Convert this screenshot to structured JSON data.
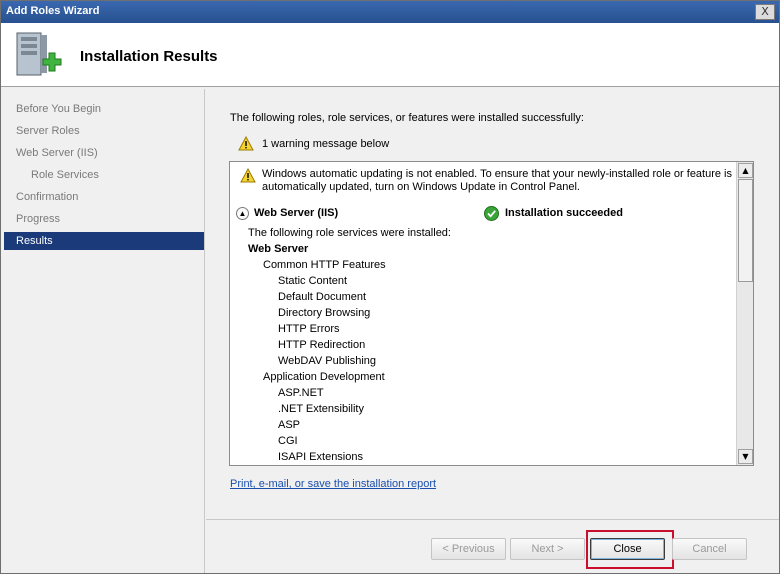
{
  "window": {
    "title": "Add Roles Wizard",
    "close_glyph": "X"
  },
  "header": {
    "title": "Installation Results",
    "icon": "server-add-icon"
  },
  "sidebar": {
    "items": [
      {
        "label": "Before You Begin",
        "state": "done"
      },
      {
        "label": "Server Roles",
        "state": "done"
      },
      {
        "label": "Web Server (IIS)",
        "state": "done"
      },
      {
        "label": "Role Services",
        "state": "done"
      },
      {
        "label": "Confirmation",
        "state": "done"
      },
      {
        "label": "Progress",
        "state": "done"
      },
      {
        "label": "Results",
        "state": "active"
      }
    ]
  },
  "main": {
    "lead": "The following roles, role services, or features were installed successfully:",
    "warning_summary": "1 warning message below",
    "results": {
      "warning_message": "Windows automatic updating is not enabled. To ensure that your newly-installed role or feature is automatically updated, turn on Windows Update in Control Panel.",
      "section_title": "Web Server (IIS)",
      "section_status": "Installation succeeded",
      "installed_intro": "The following role services were installed:",
      "lines": [
        {
          "text": "Web Server",
          "level": 0,
          "bold": true
        },
        {
          "text": "Common HTTP Features",
          "level": 1,
          "bold": false
        },
        {
          "text": "Static Content",
          "level": 2,
          "bold": false
        },
        {
          "text": "Default Document",
          "level": 2,
          "bold": false
        },
        {
          "text": "Directory Browsing",
          "level": 2,
          "bold": false
        },
        {
          "text": "HTTP Errors",
          "level": 2,
          "bold": false
        },
        {
          "text": "HTTP Redirection",
          "level": 2,
          "bold": false
        },
        {
          "text": "WebDAV Publishing",
          "level": 2,
          "bold": false
        },
        {
          "text": "Application Development",
          "level": 1,
          "bold": false
        },
        {
          "text": "ASP.NET",
          "level": 2,
          "bold": false
        },
        {
          "text": ".NET Extensibility",
          "level": 2,
          "bold": false
        },
        {
          "text": "ASP",
          "level": 2,
          "bold": false
        },
        {
          "text": "CGI",
          "level": 2,
          "bold": false
        },
        {
          "text": "ISAPI Extensions",
          "level": 2,
          "bold": false
        }
      ]
    },
    "report_link": "Print, e-mail, or save the installation report"
  },
  "buttons": {
    "previous": "< Previous",
    "next": "Next >",
    "close": "Close",
    "cancel": "Cancel"
  },
  "colors": {
    "accent": "#1a3a7a",
    "link": "#1a4fae",
    "highlight": "#c8102e",
    "title_bar": "#3a68b0"
  }
}
